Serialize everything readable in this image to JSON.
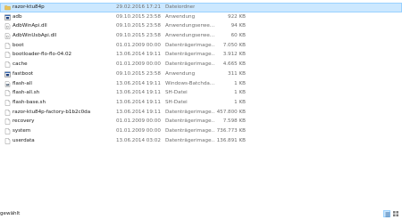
{
  "files": [
    {
      "name": "razor-ktu84p",
      "date": "29.02.2016 17:21",
      "type": "Dateiordner",
      "size": "",
      "icon": "folder-icon",
      "selected": true
    },
    {
      "name": "adb",
      "date": "09.10.2015 23:58",
      "type": "Anwendung",
      "size": "922 KB",
      "icon": "application-icon"
    },
    {
      "name": "AdbWinApi.dll",
      "date": "09.10.2015 23:58",
      "type": "Anwendungserwe...",
      "size": "94 KB",
      "icon": "dll-file-icon"
    },
    {
      "name": "AdbWinUsbApi.dll",
      "date": "09.10.2015 23:58",
      "type": "Anwendungserwe...",
      "size": "60 KB",
      "icon": "dll-file-icon"
    },
    {
      "name": "boot",
      "date": "01.01.2009 00:00",
      "type": "Datenträgerimage...",
      "size": "7.050 KB",
      "icon": "file-icon"
    },
    {
      "name": "bootloader-flo-flo-04.02",
      "date": "13.06.2014 19:11",
      "type": "Datenträgerimage...",
      "size": "3.912 KB",
      "icon": "file-icon"
    },
    {
      "name": "cache",
      "date": "01.01.2009 00:00",
      "type": "Datenträgerimage...",
      "size": "4.665 KB",
      "icon": "file-icon"
    },
    {
      "name": "fastboot",
      "date": "09.10.2015 23:58",
      "type": "Anwendung",
      "size": "311 KB",
      "icon": "application-icon"
    },
    {
      "name": "flash-all",
      "date": "13.06.2014 19:11",
      "type": "Windows-Batchda...",
      "size": "1 KB",
      "icon": "batch-file-icon"
    },
    {
      "name": "flash-all.sh",
      "date": "13.06.2014 19:11",
      "type": "SH-Datei",
      "size": "1 KB",
      "icon": "file-icon"
    },
    {
      "name": "flash-base.sh",
      "date": "13.06.2014 19:11",
      "type": "SH-Datei",
      "size": "1 KB",
      "icon": "file-icon"
    },
    {
      "name": "razor-ktu84p-factory-b1b2c0da",
      "date": "13.06.2014 19:11",
      "type": "Datenträgerimage...",
      "size": "457.800 KB",
      "icon": "file-icon"
    },
    {
      "name": "recovery",
      "date": "01.01.2009 00:00",
      "type": "Datenträgerimage...",
      "size": "7.598 KB",
      "icon": "file-icon"
    },
    {
      "name": "system",
      "date": "01.01.2009 00:00",
      "type": "Datenträgerimage...",
      "size": "736.773 KB",
      "icon": "file-icon"
    },
    {
      "name": "userdata",
      "date": "13.06.2014 03:02",
      "type": "Datenträgerimage...",
      "size": "136.891 KB",
      "icon": "file-icon"
    }
  ],
  "status_bar": {
    "selection_text": "gewählt",
    "details_view_icon": "details-view-icon",
    "large_icons_view_icon": "large-icons-view-icon"
  },
  "colors": {
    "selection_bg": "#cce8ff",
    "selection_border": "#99d1ff",
    "folder": "#e8c25a",
    "secondary_text": "#6d6d6d"
  }
}
